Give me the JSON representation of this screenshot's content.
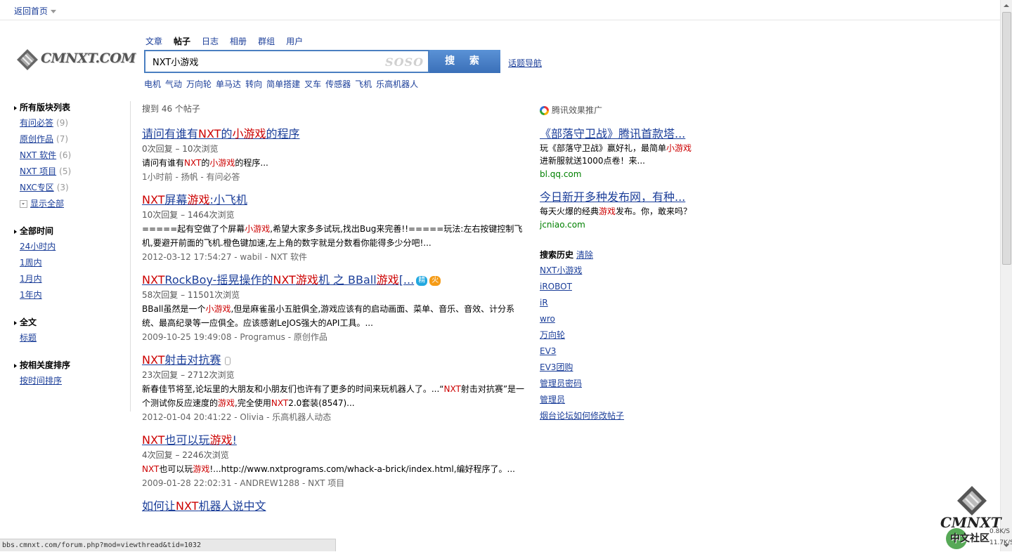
{
  "topbar": {
    "home_label": "返回首页"
  },
  "logo": {
    "text": "CMNXT.COM"
  },
  "search": {
    "tabs": [
      {
        "label": "文章",
        "active": false
      },
      {
        "label": "帖子",
        "active": true
      },
      {
        "label": "日志",
        "active": false
      },
      {
        "label": "相册",
        "active": false
      },
      {
        "label": "群组",
        "active": false
      },
      {
        "label": "用户",
        "active": false
      }
    ],
    "query": "NXT小游戏",
    "provider_mark": "SOSO",
    "button_label": "搜 索",
    "topic_nav_label": "话题导航",
    "hotwords": [
      "电机",
      "气动",
      "万向轮",
      "单马达",
      "转向",
      "简单搭建",
      "叉车",
      "传感器",
      "飞机",
      "乐高机器人"
    ]
  },
  "sidebar": {
    "forums": {
      "heading": "所有版块列表",
      "items": [
        {
          "label": "有问必答",
          "count": "(9)"
        },
        {
          "label": "原创作品",
          "count": "(7)"
        },
        {
          "label": "NXT 软件",
          "count": "(6)"
        },
        {
          "label": "NXT 项目",
          "count": "(5)"
        },
        {
          "label": "NXC专区",
          "count": "(3)"
        }
      ],
      "show_all": "显示全部"
    },
    "time": {
      "heading": "全部时间",
      "items": [
        "24小时内",
        "1周内",
        "1月内",
        "1年内"
      ]
    },
    "scope": {
      "heading": "全文",
      "items": [
        "标题"
      ]
    },
    "sort": {
      "heading": "按相关度排序",
      "items": [
        "按时间排序"
      ]
    }
  },
  "results": {
    "count_text": "搜到 46 个帖子",
    "items": [
      {
        "title": [
          {
            "t": "请问有谁有"
          },
          {
            "t": "NXT",
            "hl": true
          },
          {
            "t": "的"
          },
          {
            "t": "小游戏",
            "hl": true
          },
          {
            "t": "的程序"
          }
        ],
        "stats": "0次回复 – 10次浏览",
        "snippet": [
          {
            "t": "请问有谁有"
          },
          {
            "t": "NXT",
            "hl": true
          },
          {
            "t": "的"
          },
          {
            "t": "小游戏",
            "hl": true
          },
          {
            "t": "的程序..."
          }
        ],
        "meta": "1小时前 - 扬帆 - 有问必答"
      },
      {
        "title": [
          {
            "t": "NXT",
            "hl": true
          },
          {
            "t": "屏幕"
          },
          {
            "t": "游戏",
            "hl": true
          },
          {
            "t": ":小飞机"
          }
        ],
        "stats": "10次回复 – 1464次浏览",
        "snippet": [
          {
            "t": "=====起有空做了个屏幕"
          },
          {
            "t": "小游戏",
            "hl": true
          },
          {
            "t": ",希望大家多多试玩,找出Bug来完善!!=====玩法:左右按键控制飞机,要避开前面的飞机.橙色键加速,左上角的数字就是分数看你能得多少分吧!..."
          }
        ],
        "meta": "2012-03-12 17:54:27 - wabil - NXT 软件"
      },
      {
        "title": [
          {
            "t": "NXT",
            "hl": true
          },
          {
            "t": "RockBoy-摇晃操作的"
          },
          {
            "t": "NXT",
            "hl": true
          },
          {
            "t": "游戏",
            "hl": true
          },
          {
            "t": "机 之 BBall"
          },
          {
            "t": "游戏",
            "hl": true
          },
          {
            "t": "[..."
          }
        ],
        "badges": [
          "精",
          "火"
        ],
        "stats": "58次回复 – 11501次浏览",
        "snippet": [
          {
            "t": "BBall虽然是一个"
          },
          {
            "t": "小游戏",
            "hl": true
          },
          {
            "t": ",但是麻雀虽小五脏俱全,游戏应该有的启动画面、菜单、音乐、音效、计分系统、最高纪录等一应俱全。应该感谢LeJOS强大的API工具。..."
          }
        ],
        "meta": "2009-10-25 19:49:08 - Programus - 原创作品"
      },
      {
        "title": [
          {
            "t": "NXT",
            "hl": true
          },
          {
            "t": "射击对抗赛"
          }
        ],
        "attachment": true,
        "stats": "23次回复 – 2712次浏览",
        "snippet": [
          {
            "t": "新春佳节将至,论坛里的大朋友和小朋友们也许有了更多的时间来玩机器人了。...“"
          },
          {
            "t": "NXT",
            "hl": true
          },
          {
            "t": "射击对抗赛”是一个测试你反应速度的"
          },
          {
            "t": "游戏",
            "hl": true
          },
          {
            "t": ",完全使用"
          },
          {
            "t": "NXT",
            "hl": true
          },
          {
            "t": "2.0套装(8547)..."
          }
        ],
        "meta": "2012-01-04 20:41:22 - Olivia - 乐高机器人动态"
      },
      {
        "title": [
          {
            "t": "NXT",
            "hl": true
          },
          {
            "t": "也可以玩"
          },
          {
            "t": "游戏",
            "hl": true
          },
          {
            "t": "!"
          }
        ],
        "stats": "4次回复 – 2246次浏览",
        "snippet": [
          {
            "t": "NXT",
            "hl": true
          },
          {
            "t": "也可以玩"
          },
          {
            "t": "游戏",
            "hl": true
          },
          {
            "t": "!...http://www.nxtprograms.com/whack-a-brick/index.html,编好程序了。..."
          }
        ],
        "meta": "2009-01-28 22:02:31 - ANDREW1288 - NXT 项目"
      },
      {
        "title": [
          {
            "t": "如何让"
          },
          {
            "t": "NXT",
            "hl": true
          },
          {
            "t": "机器人说中文"
          }
        ],
        "stats": "",
        "snippet": [],
        "meta": ""
      }
    ]
  },
  "right": {
    "ad_heading": "腾讯效果推广",
    "ads": [
      {
        "title": "《部落守卫战》腾讯首款塔...",
        "desc": [
          {
            "t": "玩《部落守卫战》赢好礼，最简单"
          },
          {
            "t": "小游戏",
            "hl": true
          },
          {
            "t": "进新服就送1000点卷！来..."
          }
        ],
        "url": "bl.qq.com"
      },
      {
        "title": "今日新开多种发布网，有种...",
        "desc": [
          {
            "t": "每天火爆的经典"
          },
          {
            "t": "游戏",
            "hl": true
          },
          {
            "t": "发布。你，敢来吗？"
          }
        ],
        "url": "jcniao.com"
      }
    ],
    "history_heading": "搜索历史",
    "history_clear": "清除",
    "history": [
      "NXT小游戏",
      "iROBOT",
      "iR",
      "wro",
      "万向轮",
      "EV3",
      "EV3团购",
      "管理员密码",
      "管理员",
      "烟台论坛如何修改帖子"
    ]
  },
  "statusbar": {
    "text": "bbs.cmnxt.com/forum.php?mod=viewthread&tid=1032"
  },
  "watermark": {
    "logo": "CMNXT",
    "sub": "中文社区",
    "speed_up": "0.8K/S",
    "speed_down": "11.7K/S"
  }
}
